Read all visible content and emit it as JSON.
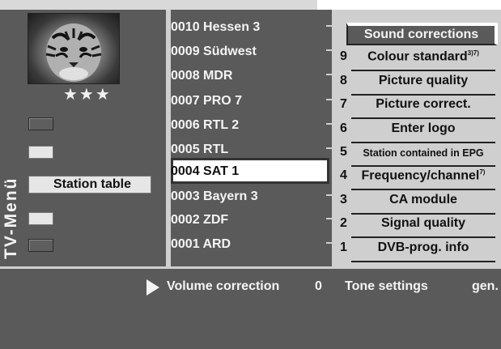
{
  "menu": {
    "vertical_title": "TV-Menü",
    "selected_item": "Station table",
    "rating": "★★★",
    "thumbnail_icon": "tiger-picture-icon"
  },
  "stations": [
    {
      "label": "0010 Hessen 3"
    },
    {
      "label": "0009 Südwest"
    },
    {
      "label": "0008 MDR"
    },
    {
      "label": "0007 PRO 7"
    },
    {
      "label": "0006 RTL 2"
    },
    {
      "label": "0005 RTL"
    },
    {
      "label": "0004 SAT 1"
    },
    {
      "label": "0003 Bayern 3"
    },
    {
      "label": "0002 ZDF"
    },
    {
      "label": "0001 ARD"
    }
  ],
  "selected_station": "0004 SAT 1",
  "settings": {
    "highlighted": "Sound corrections",
    "items": [
      {
        "num": "9",
        "label": "Colour standard",
        "sup": "3)7)"
      },
      {
        "num": "8",
        "label": "Picture quality",
        "sup": ""
      },
      {
        "num": "7",
        "label": "Picture correct.",
        "sup": ""
      },
      {
        "num": "6",
        "label": "Enter logo",
        "sup": ""
      },
      {
        "num": "5",
        "label": "Station contained in EPG",
        "sup": ""
      },
      {
        "num": "4",
        "label": "Frequency/channel",
        "sup": "7)"
      },
      {
        "num": "3",
        "label": "CA module",
        "sup": ""
      },
      {
        "num": "2",
        "label": "Signal quality",
        "sup": ""
      },
      {
        "num": "1",
        "label": "DVB-prog. info",
        "sup": ""
      }
    ]
  },
  "bottom": {
    "volume_label": "Volume correction",
    "volume_value": "0",
    "tone_label": "Tone settings",
    "tone_value": "gen."
  },
  "colors": {
    "panel_dark": "#5a5a5a",
    "panel_light": "#cfcfcf",
    "text_light": "#f4f4f4",
    "text_dark": "#111111"
  }
}
